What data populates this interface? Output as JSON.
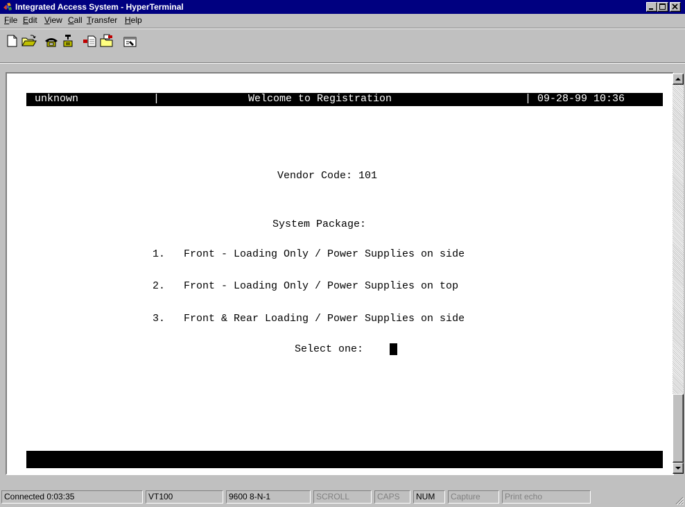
{
  "window": {
    "title": "Integrated Access System - HyperTerminal",
    "icon": "hyperterminal-app-icon",
    "controls": [
      "minimize-icon",
      "maximize-icon",
      "close-icon"
    ]
  },
  "menu": [
    {
      "accel": "F",
      "rest": "ile"
    },
    {
      "accel": "E",
      "rest": "dit"
    },
    {
      "accel": "V",
      "rest": "iew"
    },
    {
      "accel": "C",
      "rest": "all"
    },
    {
      "accel": "T",
      "rest": "ransfer"
    },
    {
      "accel": "H",
      "rest": "elp"
    }
  ],
  "toolbar": [
    "new-icon",
    "open-icon",
    "connect-icon",
    "disconnect-icon",
    "send-icon",
    "receive-icon",
    "properties-icon"
  ],
  "terminal": {
    "header_left": "unknown",
    "header_divider_left": "|",
    "header_title": "Welcome to Registration",
    "header_divider_right": "|",
    "header_datetime": "09-28-99 10:36",
    "vendor_line": "Vendor Code: 101",
    "package_heading": "System Package:",
    "options": [
      {
        "num": "1.",
        "text": "Front - Loading Only / Power Supplies on side"
      },
      {
        "num": "2.",
        "text": "Front - Loading Only / Power Supplies on top"
      },
      {
        "num": "3.",
        "text": "Front & Rear Loading / Power Supplies on side"
      }
    ],
    "prompt": "Select one:"
  },
  "status": {
    "connected": "Connected 0:03:35",
    "emulation": "VT100",
    "port_settings": "9600 8-N-1",
    "scroll": "SCROLL",
    "caps": "CAPS",
    "num": "NUM",
    "capture": "Capture",
    "print_echo": "Print echo"
  },
  "colors": {
    "titlebar": "#000080",
    "face": "#c0c0c0",
    "terminal_bg": "#ffffff",
    "terminal_fg": "#000000"
  }
}
